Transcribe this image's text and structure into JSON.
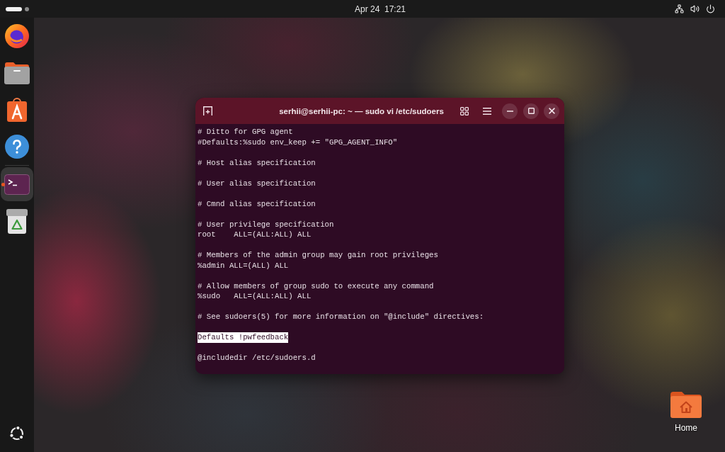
{
  "top_bar": {
    "workspaces": [
      {
        "selected": true
      },
      {
        "selected": false
      }
    ],
    "clock": "Apr 24  17:21"
  },
  "dock": {
    "groups": [
      {
        "items": [
          {
            "kind": "browser",
            "active": false
          },
          {
            "kind": "files",
            "active": false
          },
          {
            "kind": "store",
            "active": false
          },
          {
            "kind": "help",
            "active": false
          }
        ]
      },
      {
        "items": [
          {
            "kind": "terminal",
            "active": true
          },
          {
            "kind": "trash",
            "active": false
          }
        ]
      }
    ]
  },
  "terminal": {
    "title": "serhii@serhii-pc: ~ — sudo vi /etc/sudoers",
    "paragraphs": [
      [
        {
          "text": "# Ditto for GPG agent",
          "highlighted": false
        },
        {
          "text": "#Defaults:%sudo env_keep += \"GPG_AGENT_INFO\"",
          "highlighted": false
        }
      ],
      [
        {
          "text": "# Host alias specification",
          "highlighted": false
        }
      ],
      [
        {
          "text": "# User alias specification",
          "highlighted": false
        }
      ],
      [
        {
          "text": "# Cmnd alias specification",
          "highlighted": false
        }
      ],
      [
        {
          "text": "# User privilege specification",
          "highlighted": false
        },
        {
          "text": "root    ALL=(ALL:ALL) ALL",
          "highlighted": false
        }
      ],
      [
        {
          "text": "# Members of the admin group may gain root privileges",
          "highlighted": false
        },
        {
          "text": "%admin ALL=(ALL) ALL",
          "highlighted": false
        }
      ],
      [
        {
          "text": "# Allow members of group sudo to execute any command",
          "highlighted": false
        },
        {
          "text": "%sudo   ALL=(ALL:ALL) ALL",
          "highlighted": false
        }
      ],
      [
        {
          "text": "# See sudoers(5) for more information on \"@include\" directives:",
          "highlighted": false
        }
      ],
      [
        {
          "text": "Defaults !pwfeedback",
          "highlighted": true
        }
      ],
      [
        {
          "text": "@includedir /etc/sudoers.d",
          "highlighted": false
        }
      ]
    ]
  },
  "desktop_icons": [
    {
      "label": "Home"
    }
  ]
}
